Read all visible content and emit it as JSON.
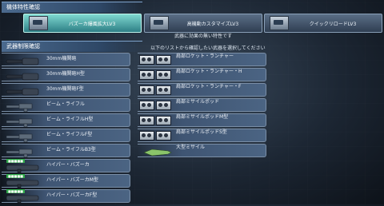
{
  "trait_section": {
    "title": "機体特性確認"
  },
  "traits": [
    {
      "label": "バズーカ爆風拡大LV3",
      "active": true
    },
    {
      "label": "高機動カスタマイズLV3",
      "active": false
    },
    {
      "label": "クイックリロードLV3",
      "active": false
    }
  ],
  "invalid_message": "武器に効果の無い特性です",
  "weapon_section": {
    "title": "武器制限確認"
  },
  "instruction": "以下のリストから確認したい武器を選択してください",
  "weapons_left": [
    {
      "label": "30mm機関砲",
      "icon": "cannon-icon",
      "tag": ""
    },
    {
      "label": "30mm機関砲H型",
      "icon": "cannon-icon",
      "tag": ""
    },
    {
      "label": "30mm機関砲F型",
      "icon": "cannon-icon",
      "tag": ""
    },
    {
      "label": "ビーム・ライフル",
      "icon": "beam-rifle-icon",
      "tag": ""
    },
    {
      "label": "ビーム・ライフルH型",
      "icon": "beam-rifle-icon",
      "tag": ""
    },
    {
      "label": "ビーム・ライフルF型",
      "icon": "beam-rifle-icon",
      "tag": ""
    },
    {
      "label": "ビーム・ライフルB3型",
      "icon": "beam-rifle-icon",
      "tag": ""
    },
    {
      "label": "ハイパー・バズーカ",
      "icon": "bazooka-icon",
      "tag": "■■■■■"
    },
    {
      "label": "ハイパー・バズーカM型",
      "icon": "bazooka-icon",
      "tag": "■■■■■"
    },
    {
      "label": "ハイパー・バズーカF型",
      "icon": "bazooka-icon",
      "tag": "■■■■■"
    }
  ],
  "weapons_right": [
    {
      "label": "肩部ロケット・ランチャー",
      "icon": "rocket-pod-icon"
    },
    {
      "label": "肩部ロケット・ランチャー・H",
      "icon": "rocket-pod-icon"
    },
    {
      "label": "肩部ロケット・ランチャー・F",
      "icon": "rocket-pod-icon"
    },
    {
      "label": "肩部ミサイルポッド",
      "icon": "missile-pod-icon"
    },
    {
      "label": "肩部ミサイルポッドM型",
      "icon": "missile-pod-icon"
    },
    {
      "label": "肩部ミサイルポッドS型",
      "icon": "missile-pod-icon"
    },
    {
      "label": "大型ミサイル",
      "icon": "large-missile-icon"
    }
  ]
}
